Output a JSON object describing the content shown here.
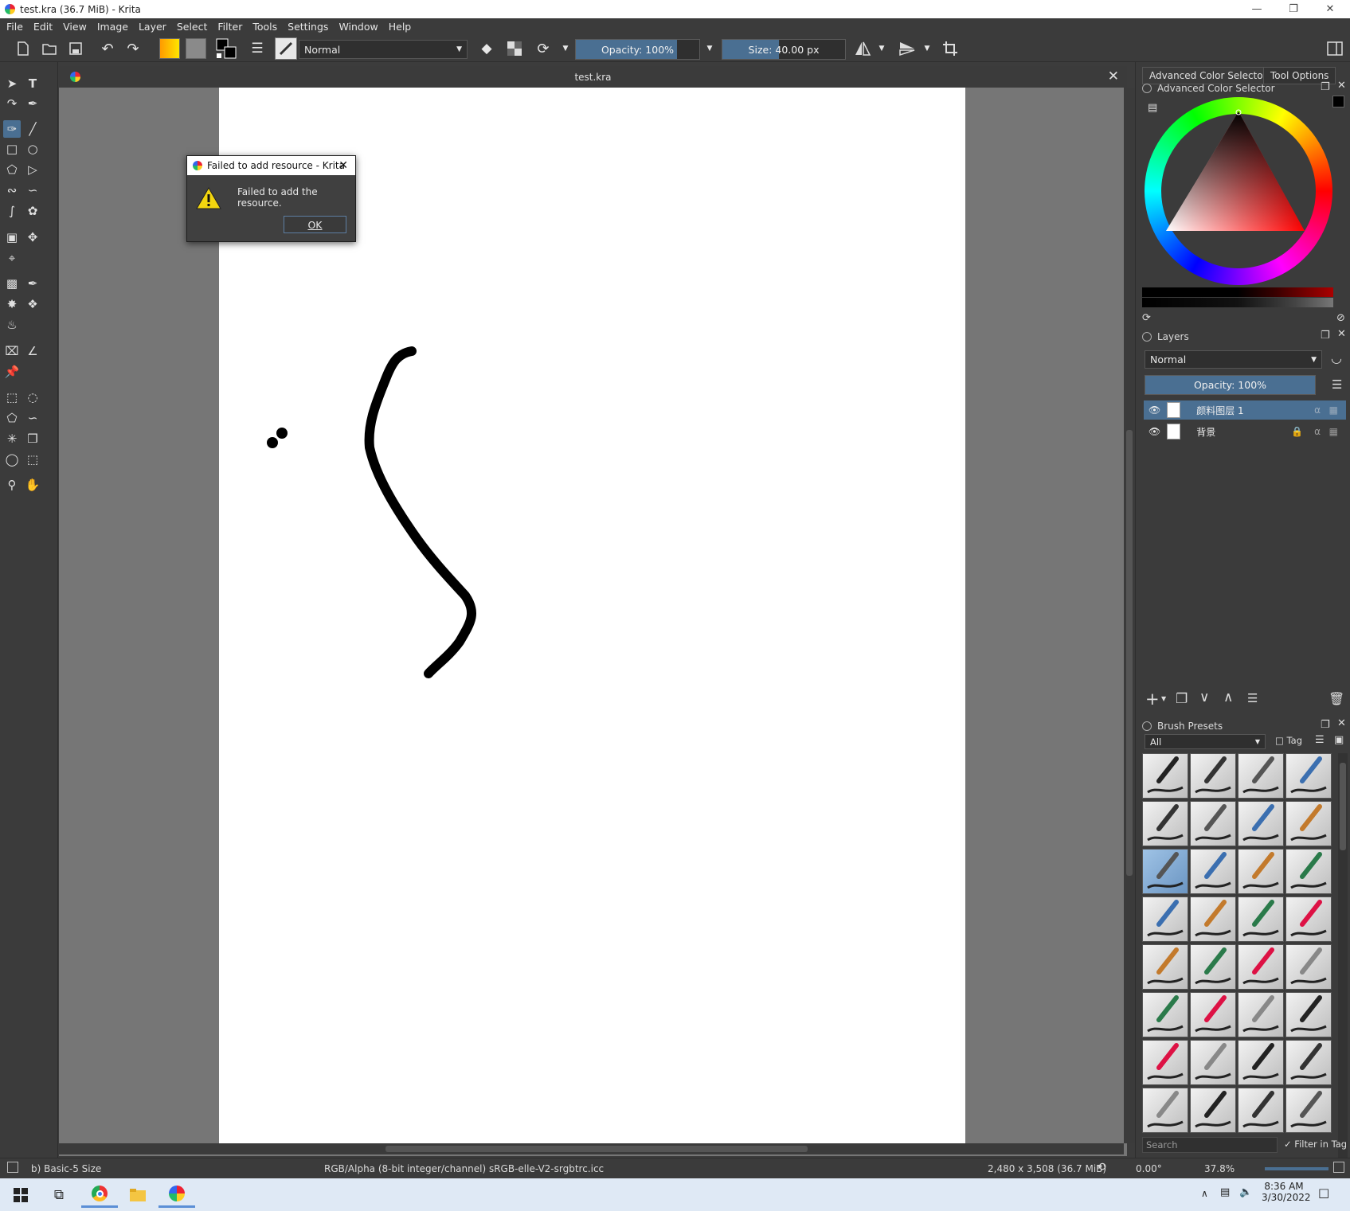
{
  "window": {
    "title": "test.kra (36.7 MiB)  - Krita"
  },
  "menu": [
    "File",
    "Edit",
    "View",
    "Image",
    "Layer",
    "Select",
    "Filter",
    "Tools",
    "Settings",
    "Window",
    "Help"
  ],
  "toolbar": {
    "blend_mode": "Normal",
    "opacity": "Opacity: 100%",
    "opacity_value": 100,
    "size": "Size: 40.00 px"
  },
  "document": {
    "tab_title": "test.kra"
  },
  "dialog": {
    "title": "Failed to add resource - Krita",
    "message": "Failed to add the resource.",
    "ok_label": "OK"
  },
  "dock": {
    "tabs": [
      "Advanced Color Selector",
      "Tool Options"
    ],
    "color_selector_title": "Advanced Color Selector",
    "layers_title": "Layers",
    "layers_blend": "Normal",
    "layers_opacity": "Opacity:  100%",
    "layers": [
      {
        "name": "颜料图层 1"
      },
      {
        "name": "背景"
      }
    ],
    "brush_presets_title": "Brush Presets",
    "brush_filter": "All",
    "tag_label": "Tag",
    "search_placeholder": "Search",
    "filter_in_tag": "Filter in Tag"
  },
  "status": {
    "brush": "b) Basic-5 Size",
    "colorspace": "RGB/Alpha (8-bit integer/channel)  sRGB-elle-V2-srgbtrc.icc",
    "dimensions": "2,480 x 3,508 (36.7 MiB)",
    "rotation": "0.00°",
    "zoom": "37.8%"
  },
  "taskbar": {
    "time": "8:36 AM",
    "date": "3/30/2022"
  },
  "colors": {
    "accent": "#4a6f92",
    "panel": "#3b3b3b",
    "canvas_bg": "#767676"
  }
}
